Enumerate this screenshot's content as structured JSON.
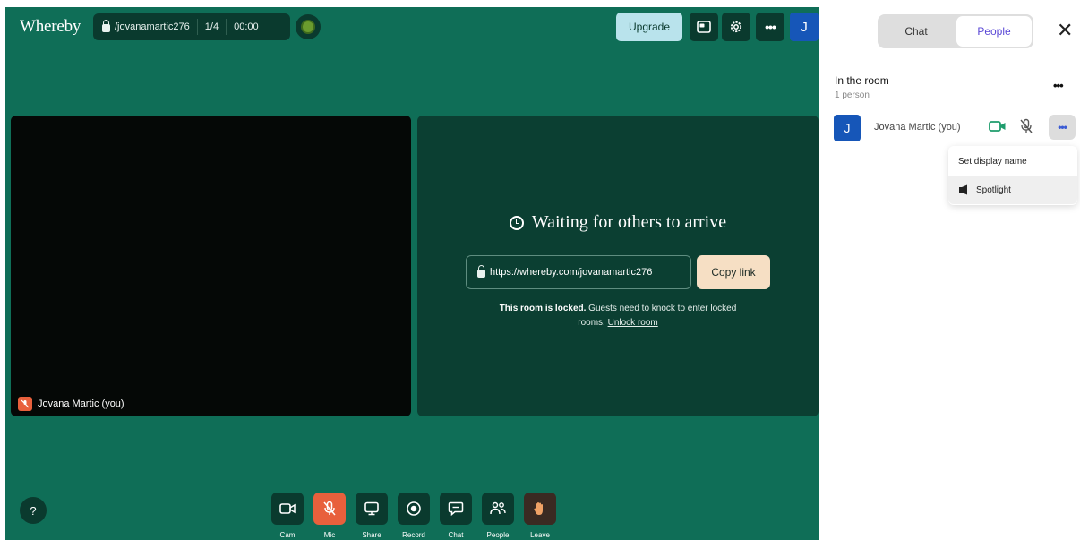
{
  "app": {
    "logo": "Whereby"
  },
  "top_bar": {
    "room_name": "/jovanamartic276",
    "participants": "1/4",
    "timer": "00:00",
    "upgrade_label": "Upgrade",
    "avatar_letter": "J"
  },
  "self_tile": {
    "name": "Jovana Martic (you)"
  },
  "waiting": {
    "title": "Waiting for others to arrive",
    "link": "https://whereby.com/jovanamartic276",
    "copy_label": "Copy link",
    "locked_bold": "This room is locked.",
    "locked_text": " Guests need to knock to enter locked rooms. ",
    "unlock_label": "Unlock room"
  },
  "help": {
    "label": "?"
  },
  "toolbar": {
    "cam": "Cam",
    "mic": "Mic",
    "share": "Share",
    "record": "Record",
    "chat": "Chat",
    "people": "People",
    "leave": "Leave"
  },
  "panel": {
    "tab_chat": "Chat",
    "tab_people": "People",
    "close_label": "✕",
    "section_title": "In the room",
    "section_count": "1 person",
    "participant": {
      "letter": "J",
      "name": "Jovana Martic (you)"
    },
    "menu": {
      "set_display_name": "Set display name",
      "spotlight": "Spotlight"
    }
  },
  "colors": {
    "stage_bg": "#0f6e57",
    "tile_dark": "#050806",
    "tile_teal": "#0b3f32",
    "button_dark": "#0a3a2e",
    "mic_off": "#e8603c",
    "upgrade": "#b9e3ec",
    "copy_link": "#f6dfc4",
    "avatar_blue": "#1656b8",
    "people_tab_text": "#5a48d6"
  }
}
